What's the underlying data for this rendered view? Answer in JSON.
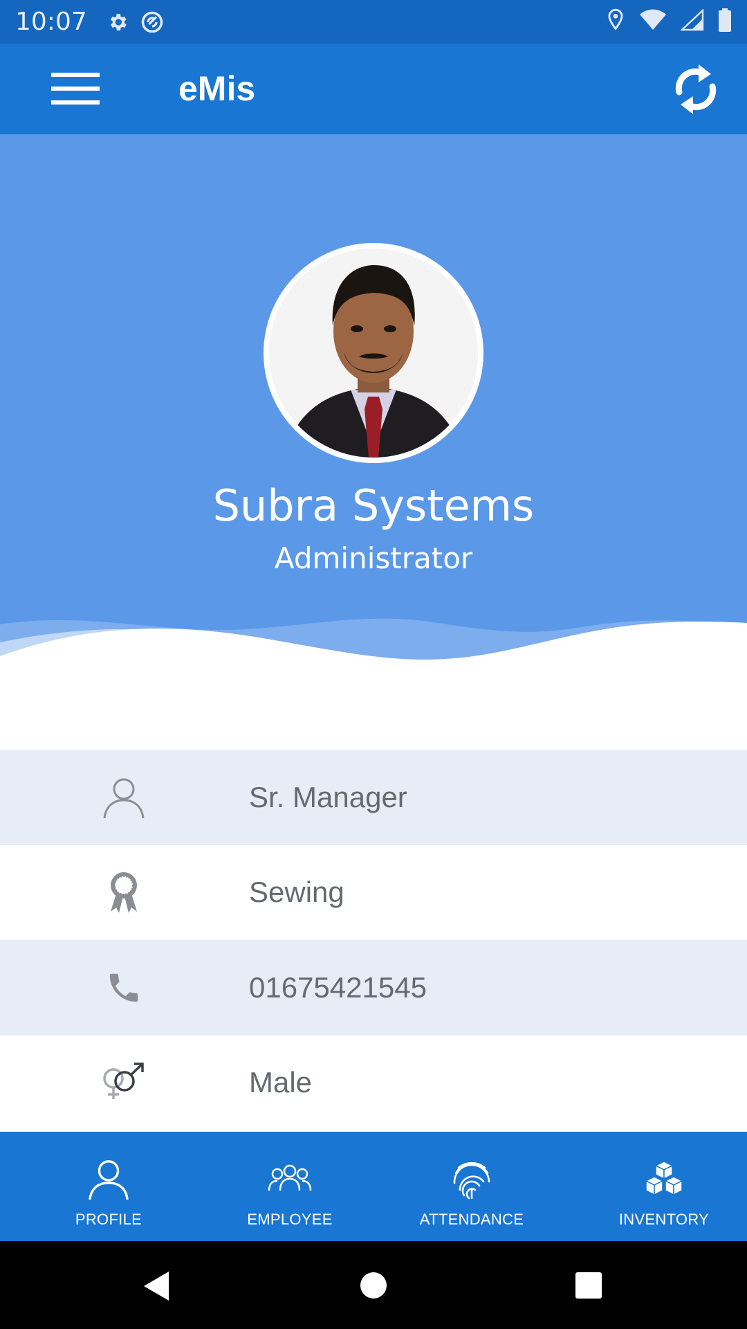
{
  "status_bar": {
    "time": "10:07",
    "left_icons": [
      "gear-icon",
      "sync-circle-icon"
    ],
    "right_icons": [
      "location-icon",
      "wifi-icon",
      "signal-icon",
      "battery-icon"
    ]
  },
  "app_bar": {
    "title": "eMis",
    "menu_icon": "menu-icon",
    "refresh_icon": "refresh-icon"
  },
  "profile": {
    "name": "Subra Systems",
    "role": "Administrator"
  },
  "info_rows": [
    {
      "icon": "person-icon",
      "value": "Sr. Manager"
    },
    {
      "icon": "award-ribbon-icon",
      "value": "Sewing"
    },
    {
      "icon": "phone-icon",
      "value": "01675421545"
    },
    {
      "icon": "gender-icon",
      "value": "Male"
    }
  ],
  "bottom_nav": [
    {
      "icon": "profile-icon",
      "label": "PROFILE"
    },
    {
      "icon": "group-icon",
      "label": "EMPLOYEE"
    },
    {
      "icon": "fingerprint-icon",
      "label": "ATTENDANCE"
    },
    {
      "icon": "boxes-icon",
      "label": "INVENTORY"
    }
  ],
  "colors": {
    "status_bar": "#1466be",
    "app_bar": "#1976d2",
    "header": "#5b99e8",
    "row_alt": "#e7edf6",
    "row_text": "#666a70"
  }
}
